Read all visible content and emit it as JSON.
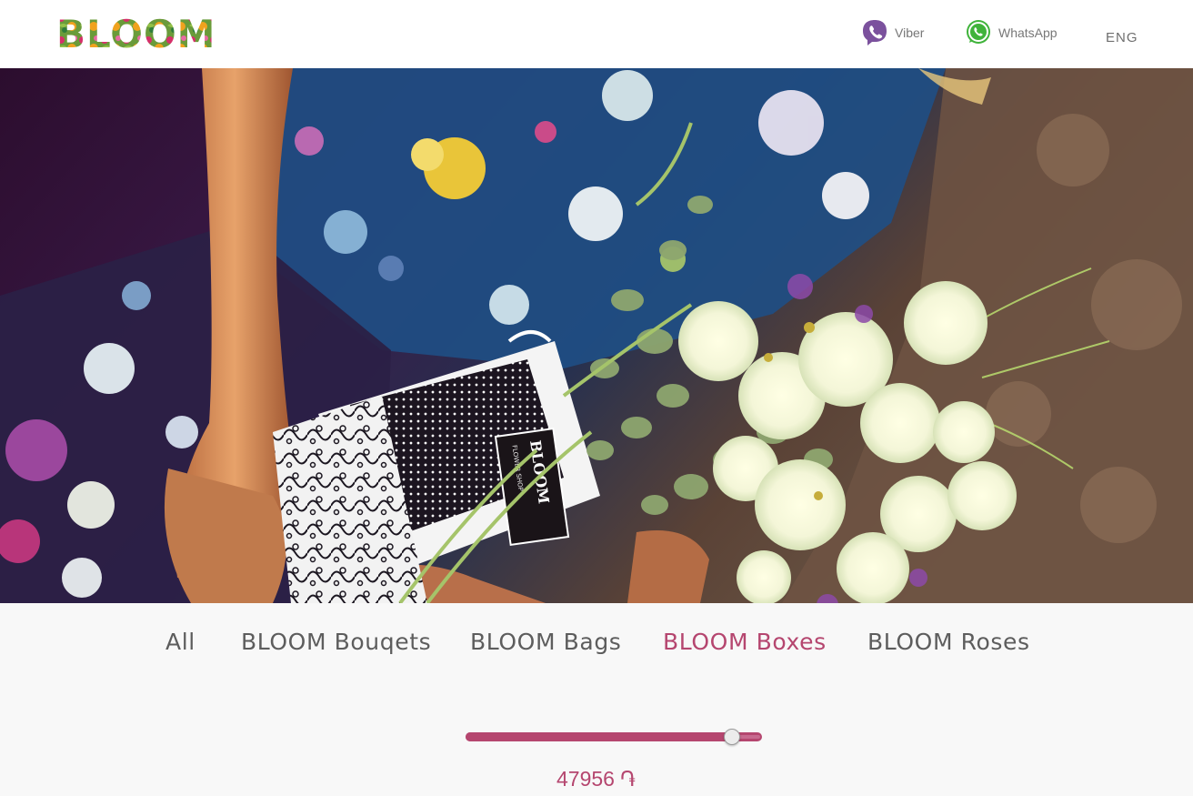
{
  "brand": {
    "logo_text": "BLOOM"
  },
  "header": {
    "contacts": [
      {
        "label": "Viber",
        "icon": "viber-icon",
        "color": "#7b519d"
      },
      {
        "label": "WhatsApp",
        "icon": "whatsapp-icon",
        "color": "#3fb33a"
      }
    ],
    "language": "ENG"
  },
  "hero": {
    "bag_tag_text": "BLOOM",
    "bag_tag_subtext": "FLOWER SHOP"
  },
  "categories": {
    "tabs": [
      {
        "label": "All",
        "active": false
      },
      {
        "label": "BLOOM Bouqets",
        "active": false
      },
      {
        "label": "BLOOM Bags",
        "active": false
      },
      {
        "label": "BLOOM Boxes",
        "active": true
      },
      {
        "label": "BLOOM Roses",
        "active": false
      }
    ]
  },
  "price_filter": {
    "value": "47956",
    "currency": "֏",
    "level_fraction": 0.9
  },
  "colors": {
    "accent": "#b5466f",
    "tab_text": "#5d5d5d",
    "header_bg": "#ffffff",
    "page_bg": "#f8f8f8"
  }
}
